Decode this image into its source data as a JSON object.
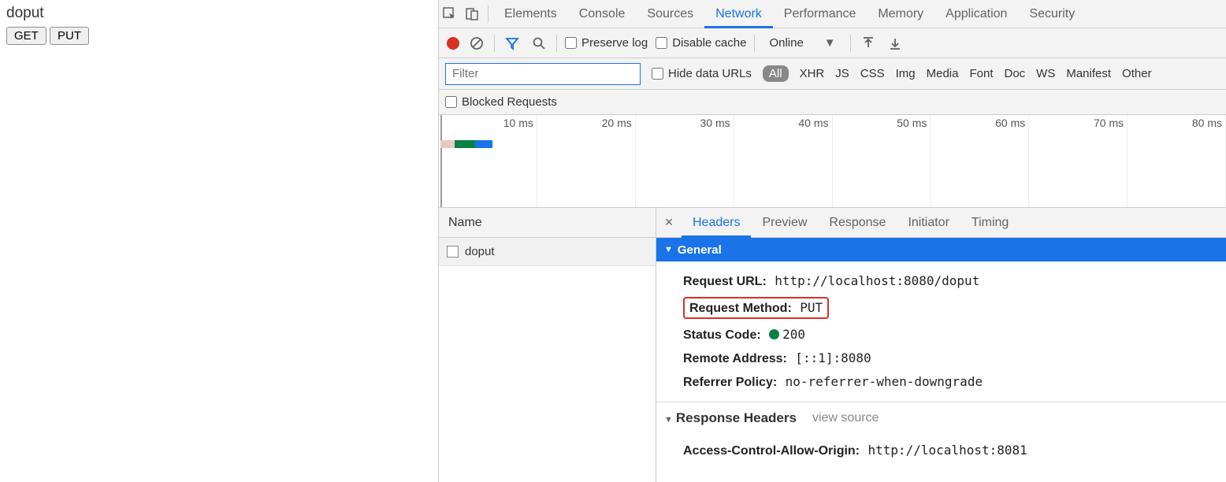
{
  "page": {
    "title": "doput",
    "buttons": {
      "get": "GET",
      "put": "PUT"
    }
  },
  "devtools": {
    "tabs": [
      "Elements",
      "Console",
      "Sources",
      "Network",
      "Performance",
      "Memory",
      "Application",
      "Security"
    ],
    "activeTab": "Network",
    "toolbar": {
      "preserveLog": "Preserve log",
      "disableCache": "Disable cache",
      "online": "Online"
    },
    "filter": {
      "placeholder": "Filter",
      "hideDataUrls": "Hide data URLs",
      "all": "All",
      "types": [
        "XHR",
        "JS",
        "CSS",
        "Img",
        "Media",
        "Font",
        "Doc",
        "WS",
        "Manifest",
        "Other"
      ]
    },
    "blockedRequests": "Blocked Requests",
    "timeline": {
      "ticks": [
        "10 ms",
        "20 ms",
        "30 ms",
        "40 ms",
        "50 ms",
        "60 ms",
        "70 ms",
        "80 ms"
      ]
    },
    "requestList": {
      "nameHeader": "Name",
      "items": [
        "doput"
      ]
    },
    "detailTabs": [
      "Headers",
      "Preview",
      "Response",
      "Initiator",
      "Timing"
    ],
    "activeDetailTab": "Headers",
    "headers": {
      "generalLabel": "General",
      "general": {
        "requestUrlLabel": "Request URL:",
        "requestUrl": "http://localhost:8080/doput",
        "requestMethodLabel": "Request Method:",
        "requestMethod": "PUT",
        "statusCodeLabel": "Status Code:",
        "statusCode": "200",
        "remoteAddressLabel": "Remote Address:",
        "remoteAddress": "[::1]:8080",
        "referrerPolicyLabel": "Referrer Policy:",
        "referrerPolicy": "no-referrer-when-downgrade"
      },
      "responseHeadersLabel": "Response Headers",
      "viewSource": "view source",
      "response": {
        "acaoLabel": "Access-Control-Allow-Origin:",
        "acao": "http://localhost:8081"
      }
    }
  }
}
